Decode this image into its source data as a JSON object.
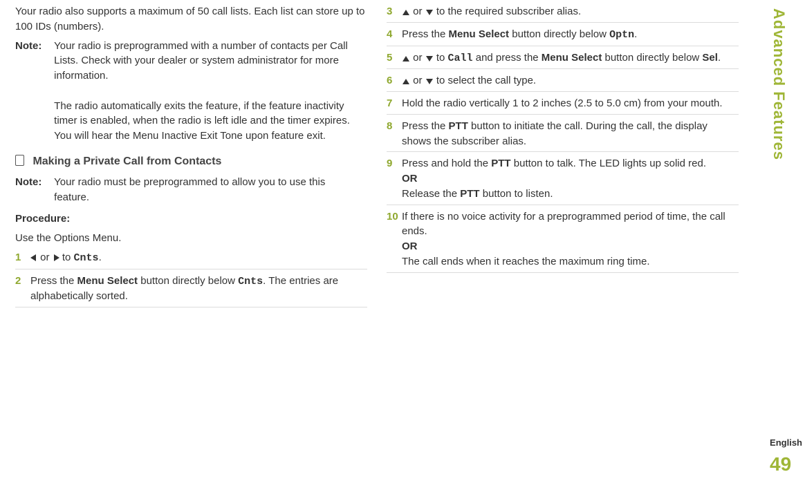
{
  "left": {
    "intro": "Your radio also supports a maximum of 50 call lists. Each list can store up to 100 IDs (numbers).",
    "note_label": "Note:",
    "note_para1": "Your radio is preprogrammed with a number of contacts per Call Lists. Check with your dealer or system administrator for more information.",
    "note_para2": "The radio automatically exits the feature, if the feature inactivity timer is enabled, when the radio is left idle and the timer expires. You will hear the Menu Inactive Exit Tone upon feature exit.",
    "section_title": "Making a Private Call from Contacts",
    "note2_label": "Note:",
    "note2_body": "Your radio must be preprogrammed to allow you to use this feature.",
    "procedure_label": "Procedure:",
    "procedure_intro": "Use the Options Menu.",
    "step1_or": " or ",
    "step1_to": " to ",
    "step1_target": "Cnts",
    "step1_dot": ".",
    "step2_a": "Press the ",
    "step2_b": "Menu Select",
    "step2_c": " button directly below ",
    "step2_d": "Cnts",
    "step2_e": ". The entries are alphabetically sorted."
  },
  "right": {
    "step3_or": " or ",
    "step3_rest": " to the required subscriber alias.",
    "step4_a": "Press the ",
    "step4_b": "Menu Select",
    "step4_c": " button directly below ",
    "step4_d": "Optn",
    "step4_e": ".",
    "step5_or": " or ",
    "step5_to": " to ",
    "step5_call": "Call",
    "step5_mid": " and press the ",
    "step5_ms": "Menu Select",
    "step5_mid2": " button directly below ",
    "step5_sel": "Sel",
    "step5_dot": ".",
    "step6_or": " or ",
    "step6_rest": " to select the call type.",
    "step7": "Hold the radio vertically 1 to 2 inches (2.5 to 5.0 cm) from your mouth.",
    "step8_a": "Press the ",
    "step8_b": "PTT",
    "step8_c": " button to initiate the call. During the call, the display shows the subscriber alias.",
    "step9_a": "Press and hold the ",
    "step9_b": "PTT",
    "step9_c": " button to talk. The LED lights up solid red.",
    "step9_or": "OR",
    "step9_d": "Release the ",
    "step9_e": "PTT",
    "step9_f": " button to listen.",
    "step10_a": "If there is no voice activity for a preprogrammed period of time, the call ends.",
    "step10_or": "OR",
    "step10_b": "The call ends when it reaches the maximum ring time."
  },
  "nums": {
    "n1": "1",
    "n2": "2",
    "n3": "3",
    "n4": "4",
    "n5": "5",
    "n6": "6",
    "n7": "7",
    "n8": "8",
    "n9": "9",
    "n10": "10"
  },
  "side": {
    "label": "Advanced Features",
    "english": "English",
    "page": "49"
  }
}
